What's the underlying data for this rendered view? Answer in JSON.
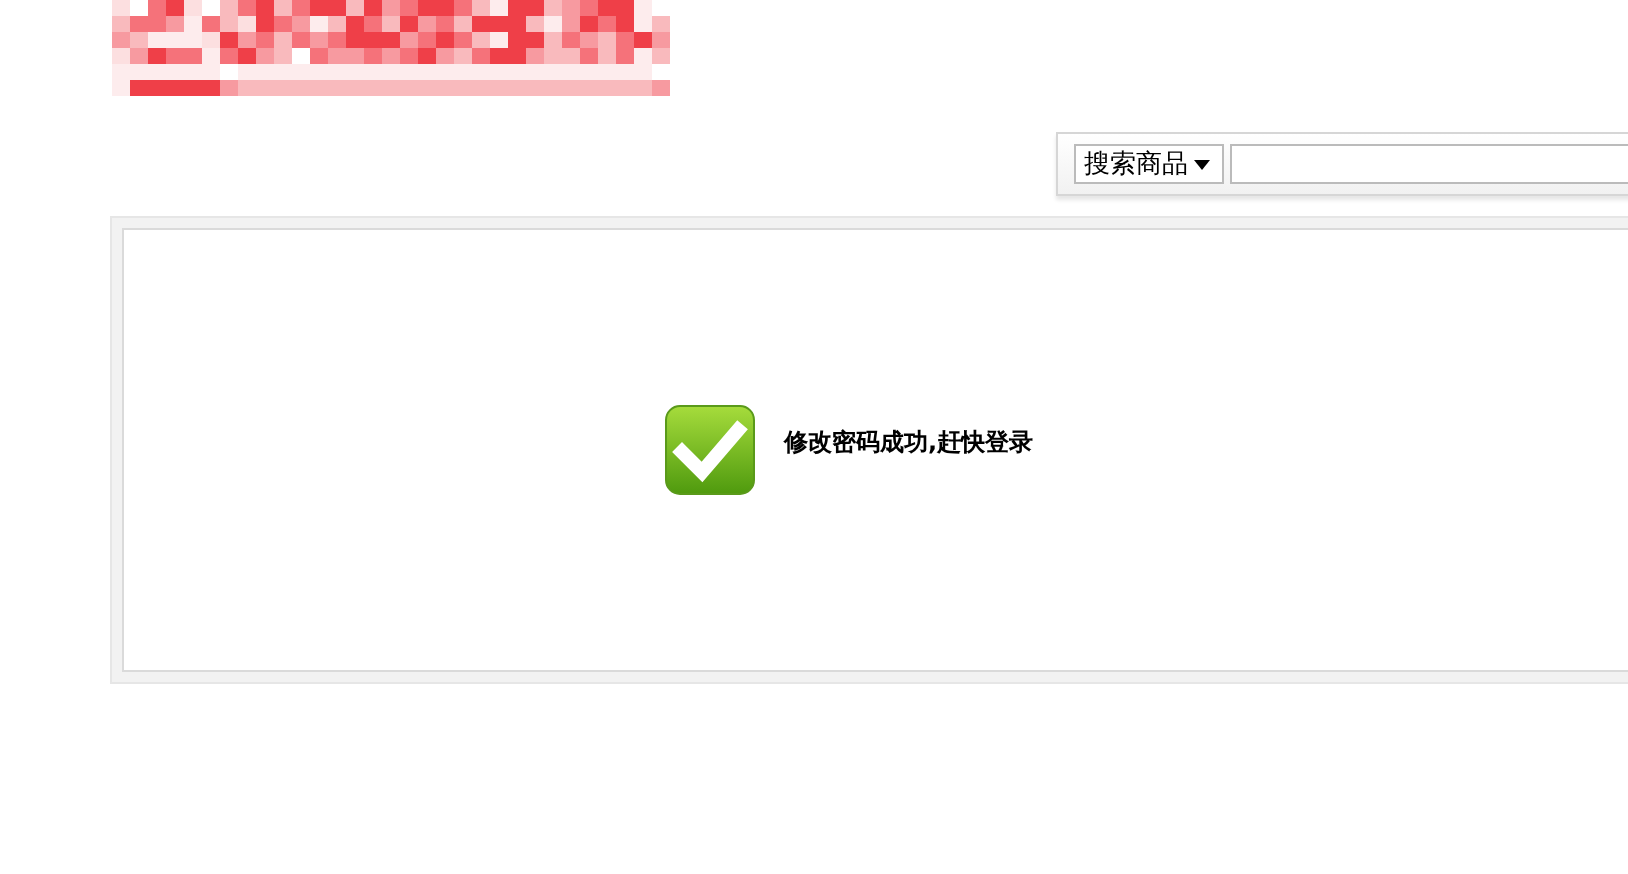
{
  "search": {
    "scope": "搜索商品"
  },
  "message": {
    "kind": "success",
    "text": "修改密码成功,赶快登录"
  }
}
